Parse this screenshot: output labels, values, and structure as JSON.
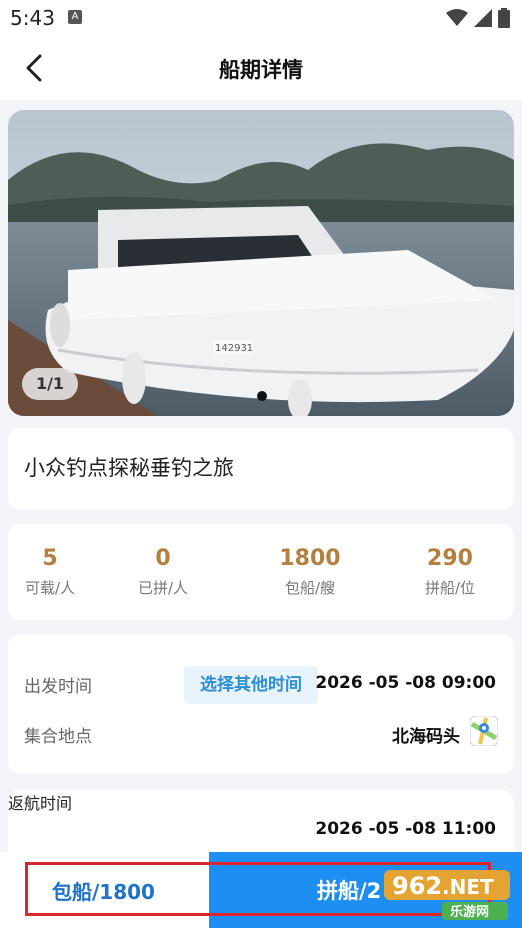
{
  "status_bar": {
    "time": "5:43"
  },
  "nav": {
    "title": "船期详情"
  },
  "gallery": {
    "counter": "1/1",
    "hull_number": "142931"
  },
  "trip": {
    "name": "小众钓点探秘垂钓之旅"
  },
  "stats": [
    {
      "value": "5",
      "label": "可载/人"
    },
    {
      "value": "0",
      "label": "已拼/人"
    },
    {
      "value": "1800",
      "label": "包船/艘"
    },
    {
      "value": "290",
      "label": "拼船/位"
    }
  ],
  "departure": {
    "label": "出发时间",
    "other_time_button": "选择其他时间",
    "datetime": "2026 -05 -08 09:00"
  },
  "meeting": {
    "label": "集合地点",
    "place": "北海码头"
  },
  "return_trip": {
    "label": "返航时间",
    "datetime": "2026 -05 -08 11:00"
  },
  "actions": {
    "charter_label": "包船/1800",
    "share_label": "拼船/2"
  },
  "watermark": {
    "text_a": "962",
    "text_b": ".NET",
    "text_c": "乐游网"
  },
  "colors": {
    "accent": "#1e8ef2",
    "price": "#b4803f",
    "highlight_frame": "#d9262e"
  }
}
